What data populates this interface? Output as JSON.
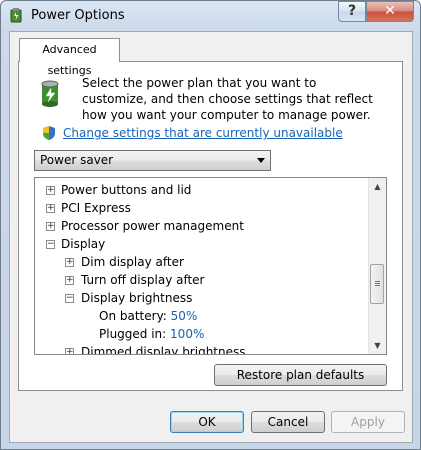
{
  "window": {
    "title": "Power Options",
    "help_label": "?",
    "close_label": "✕"
  },
  "tabs": [
    {
      "label": "Advanced settings"
    }
  ],
  "description": "Select the power plan that you want to customize, and then choose settings that reflect how you want your computer to manage power.",
  "change_link": "Change settings that are currently unavailable",
  "plan_select": {
    "value": "Power saver"
  },
  "tree": [
    {
      "label": "Power buttons and lid",
      "expander": "+"
    },
    {
      "label": "PCI Express",
      "expander": "+"
    },
    {
      "label": "Processor power management",
      "expander": "+"
    },
    {
      "label": "Display",
      "expander": "−"
    },
    {
      "label": "Dim display after",
      "expander": "+"
    },
    {
      "label": "Turn off display after",
      "expander": "+"
    },
    {
      "label": "Display brightness",
      "expander": "−"
    },
    {
      "label": "On battery:",
      "value": "50%"
    },
    {
      "label": "Plugged in:",
      "value": "100%"
    },
    {
      "label": "Dimmed display brightness",
      "expander": "+"
    }
  ],
  "buttons": {
    "restore": "Restore plan defaults",
    "ok": "OK",
    "cancel": "Cancel",
    "apply": "Apply"
  },
  "colors": {
    "link": "#1664b8",
    "value": "#1e5fb0"
  }
}
